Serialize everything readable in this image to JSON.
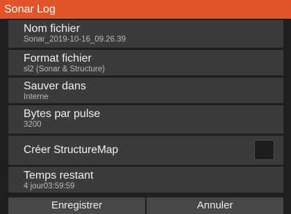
{
  "dialog": {
    "title": "Sonar Log",
    "fields": [
      {
        "label": "Nom fichier",
        "value": "Sonar_2019-10-16_09.26.39"
      },
      {
        "label": "Format fichier",
        "value": "sl2 (Sonar & Structure)"
      },
      {
        "label": "Sauver dans",
        "value": "Interne"
      },
      {
        "label": "Bytes par pulse",
        "value": "3200"
      },
      {
        "label": "Créer StructureMap",
        "checked": false
      },
      {
        "label": "Temps restant",
        "value": "4 jour03:59:59"
      }
    ],
    "buttons": {
      "record": "Enregistrer",
      "cancel": "Annuler"
    }
  },
  "colors": {
    "title_bar": "#e2552a",
    "row_bg": "#3b3b3b",
    "button_bg": "#474747"
  }
}
